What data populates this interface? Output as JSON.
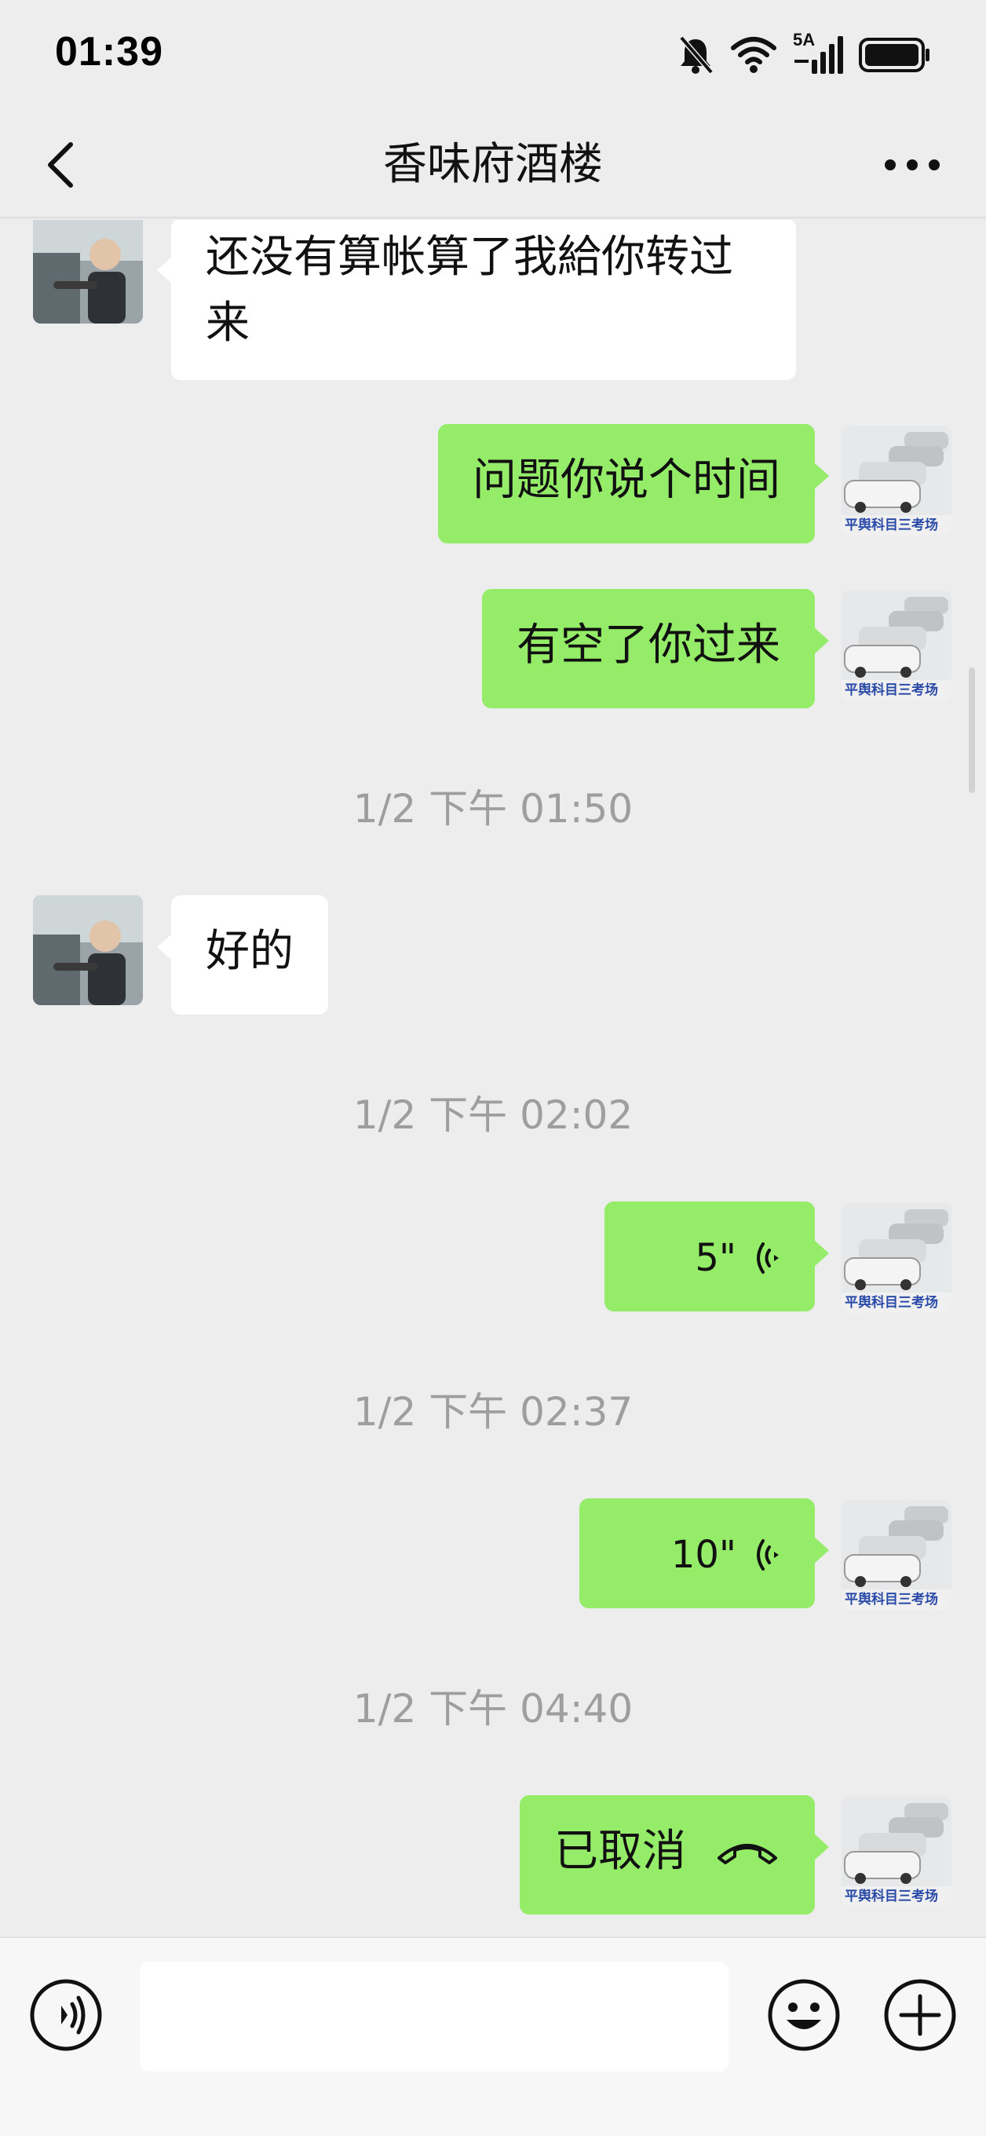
{
  "status_bar": {
    "time": "01:39",
    "network_label": "5A",
    "icons": [
      "mute-bell-icon",
      "wifi-icon",
      "signal-icon",
      "battery-icon"
    ]
  },
  "nav": {
    "title": "香味府酒楼",
    "back_icon": "chevron-left-icon",
    "more_icon": "more-dots-icon"
  },
  "messages": [
    {
      "from": "other",
      "type": "text",
      "text": "还没有算帐算了我給你转过\n来"
    },
    {
      "from": "me",
      "type": "text",
      "text": "问题你说个时间"
    },
    {
      "from": "me",
      "type": "text",
      "text": "有空了你过来"
    },
    {
      "type": "timestamp",
      "text": "1/2 下午 01:50"
    },
    {
      "from": "other",
      "type": "text",
      "text": "好的"
    },
    {
      "type": "timestamp",
      "text": "1/2 下午 02:02"
    },
    {
      "from": "me",
      "type": "voice",
      "duration": "5\""
    },
    {
      "type": "timestamp",
      "text": "1/2 下午 02:37"
    },
    {
      "from": "me",
      "type": "voice",
      "duration": "10\""
    },
    {
      "type": "timestamp",
      "text": "1/2 下午 04:40"
    },
    {
      "from": "me",
      "type": "call",
      "text": "已取消"
    }
  ],
  "my_avatar_caption": "平舆科目三考场",
  "input_bar": {
    "placeholder": "",
    "icons": [
      "voice-mode-icon",
      "emoji-icon",
      "plus-icon"
    ]
  },
  "colors": {
    "background": "#ededed",
    "outgoing_bubble": "#95ec69",
    "incoming_bubble": "#ffffff",
    "timestamp_text": "#9e9e9e"
  }
}
